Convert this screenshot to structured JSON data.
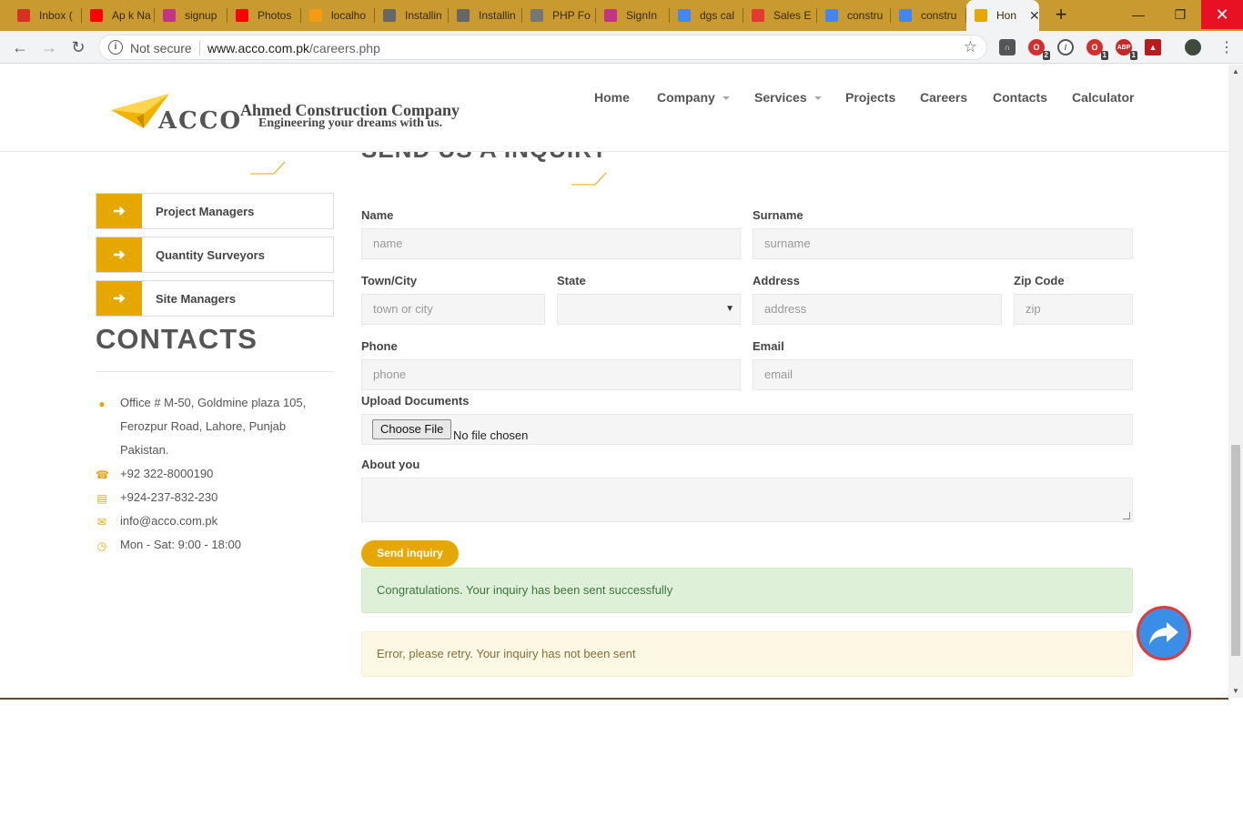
{
  "browser": {
    "tabs": [
      {
        "title": "Inbox (",
        "icon": "gmail-icon",
        "color": "#d93025"
      },
      {
        "title": "Ap k Na",
        "icon": "youtube-icon",
        "color": "#ff0000"
      },
      {
        "title": "signup",
        "icon": "instagram-icon",
        "color": "#c13584"
      },
      {
        "title": "Photos",
        "icon": "youtube-icon",
        "color": "#ff0000"
      },
      {
        "title": "localho",
        "icon": "phpmyadmin-icon",
        "color": "#f39c12"
      },
      {
        "title": "Installin",
        "icon": "jg-icon",
        "color": "#666666"
      },
      {
        "title": "Installin",
        "icon": "jg-icon",
        "color": "#666666"
      },
      {
        "title": "PHP Fo",
        "icon": "globe-icon",
        "color": "#777777"
      },
      {
        "title": "SignIn",
        "icon": "instagram-icon",
        "color": "#c13584"
      },
      {
        "title": "dgs cal",
        "icon": "google-icon",
        "color": "#4285f4"
      },
      {
        "title": "Sales E",
        "icon": "sales-icon",
        "color": "#e53935"
      },
      {
        "title": "constru",
        "icon": "google-icon",
        "color": "#4285f4"
      },
      {
        "title": "constru",
        "icon": "google-icon",
        "color": "#4285f4"
      },
      {
        "title": "Hon",
        "icon": "acco-icon",
        "color": "#e6a800",
        "active": true
      }
    ],
    "security_label": "Not secure",
    "url_host": "www.acco.com.pk",
    "url_path": "/careers.php",
    "extension_badges": [
      "2",
      "1",
      "1"
    ]
  },
  "site": {
    "logo_text": "ACCO",
    "company_name": "Ahmed Construction Company",
    "tagline": "Engineering your dreams with us.",
    "nav": [
      {
        "label": "Home",
        "dropdown": false
      },
      {
        "label": "Company",
        "dropdown": true
      },
      {
        "label": "Services",
        "dropdown": true
      },
      {
        "label": "Projects",
        "dropdown": false
      },
      {
        "label": "Careers",
        "dropdown": false
      },
      {
        "label": "Contacts",
        "dropdown": false
      },
      {
        "label": "Calculator",
        "dropdown": false
      }
    ],
    "accent_color": "#e6a800"
  },
  "sidebar": {
    "items": [
      {
        "label": "Project Managers"
      },
      {
        "label": "Quantity Surveyors"
      },
      {
        "label": "Site Managers"
      }
    ],
    "contacts_title": "CONTACTS",
    "contacts": [
      {
        "icon": "map-pin-icon",
        "lines": [
          "Office # M-50, Goldmine plaza 105,",
          "Ferozpur Road, Lahore, Punjab",
          "Pakistan."
        ]
      },
      {
        "icon": "phone-icon",
        "lines": [
          "+92 322-8000190"
        ]
      },
      {
        "icon": "fax-icon",
        "lines": [
          "+924-237-832-230"
        ]
      },
      {
        "icon": "envelope-icon",
        "lines": [
          "info@acco.com.pk"
        ]
      },
      {
        "icon": "clock-icon",
        "lines": [
          "Mon - Sat: 9:00 - 18:00"
        ]
      }
    ]
  },
  "form": {
    "heading": "SEND US A INQUIRY",
    "name": {
      "label": "Name",
      "placeholder": "name",
      "value": ""
    },
    "surname": {
      "label": "Surname",
      "placeholder": "surname",
      "value": ""
    },
    "town": {
      "label": "Town/City",
      "placeholder": "town or city",
      "value": ""
    },
    "state": {
      "label": "State",
      "value": ""
    },
    "address": {
      "label": "Address",
      "placeholder": "address",
      "value": ""
    },
    "zip": {
      "label": "Zip Code",
      "placeholder": "zip",
      "value": ""
    },
    "phone": {
      "label": "Phone",
      "placeholder": "phone",
      "value": ""
    },
    "email": {
      "label": "Email",
      "placeholder": "email",
      "value": ""
    },
    "upload": {
      "label": "Upload Documents",
      "button": "Choose File",
      "status": "No file chosen"
    },
    "about": {
      "label": "About you",
      "value": ""
    },
    "submit_label": "Send inquiry",
    "success_message": "Congratulations. Your inquiry has been sent successfully",
    "error_message": "Error, please retry. Your inquiry has not been sent"
  }
}
